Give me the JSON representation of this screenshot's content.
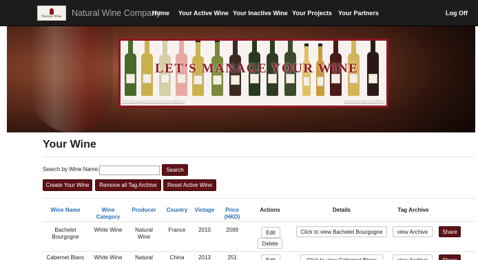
{
  "nav": {
    "logo_text": "Natural Wine",
    "brand": "Natural Wine Company",
    "links": [
      "Home",
      "Your Active Wine",
      "Your Inactive Wine",
      "Your Projects",
      "Your Partners"
    ],
    "logoff": "Log Off"
  },
  "banner": {
    "title": "LET'S MANAGE YOUR WINE",
    "made_with": "MADE WITH MYBANNERMAKER.COM",
    "hosted_by": "HOSTED BY IMGUR.COM"
  },
  "page": {
    "title": "Your Wine",
    "search_label": "Search by Wine Name:",
    "search_value": "",
    "search_button": "Search",
    "create_button": "Create Your Wine",
    "remove_button": "Remove all Tag Archive",
    "reset_button": "Reset Active Wine"
  },
  "table": {
    "headers": {
      "wine_name": "Wine Name",
      "wine_category": "Wine Category",
      "producer": "Producer",
      "country": "Country",
      "vintage": "Vintage",
      "price": "Price (HKD)",
      "actions": "Actions",
      "details": "Details",
      "tag_archive": "Tag Archive"
    },
    "rows": [
      {
        "name": "Bachelet Bourgogne",
        "category": "White Wine",
        "producer": "Natural Wine",
        "country": "France",
        "vintage": "2010",
        "price": "2099",
        "edit": "Edit",
        "delete": "Delete",
        "details": "Click to view Bachelet Bourgogne",
        "archive": "view Archive",
        "share": "Share"
      },
      {
        "name": "Cabernet Blanc",
        "category": "White Wine",
        "producer": "Natural",
        "country": "China",
        "vintage": "2013",
        "price": "251",
        "edit": "Edit",
        "details": "Click to view Cabernet Blanc",
        "archive": "view Archive",
        "share": "Share"
      }
    ]
  },
  "colors": {
    "navbar": "#1c1c1c",
    "button_dark": "#5e1216",
    "header_link": "#2a6db5",
    "banner_border": "#8d1622"
  }
}
